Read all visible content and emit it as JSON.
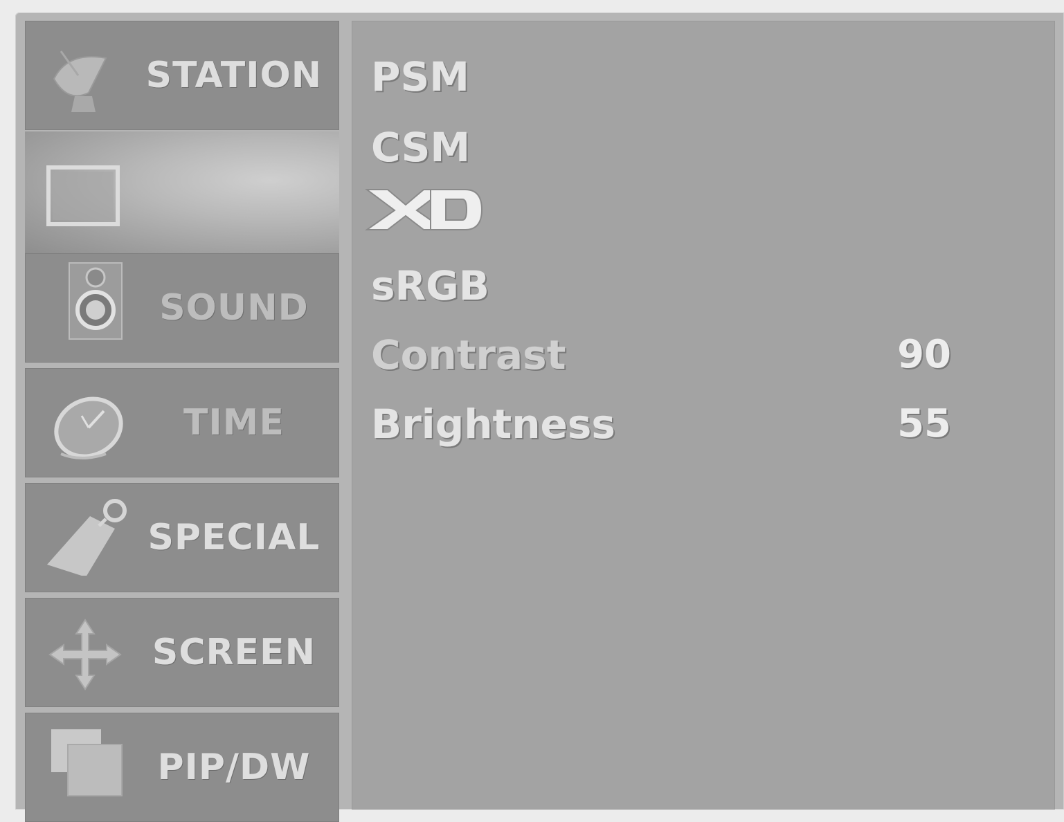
{
  "menu": {
    "items": [
      {
        "label": "STATION",
        "icon": "satellite-dish-icon",
        "active": false
      },
      {
        "label": "",
        "icon": "picture-screen-icon",
        "active": true
      },
      {
        "label": "SOUND",
        "icon": "speaker-icon",
        "active": false
      },
      {
        "label": "TIME",
        "icon": "clock-icon",
        "active": false
      },
      {
        "label": "SPECIAL",
        "icon": "tag-icon",
        "active": false
      },
      {
        "label": "SCREEN",
        "icon": "move-arrows-icon",
        "active": false
      },
      {
        "label": "PIP/DW",
        "icon": "overlapping-windows-icon",
        "active": false
      }
    ]
  },
  "picture_menu": {
    "options": [
      {
        "label": "PSM"
      },
      {
        "label": "CSM"
      },
      {
        "label": "XD",
        "display": "logo"
      },
      {
        "label": "sRGB"
      },
      {
        "label": "Contrast",
        "value": "90"
      },
      {
        "label": "Brightness",
        "value": "55"
      }
    ]
  },
  "colors": {
    "menu_bg": "#8d8d8d",
    "panel_bg": "#a3a3a3",
    "text": "#e4e4e4"
  }
}
